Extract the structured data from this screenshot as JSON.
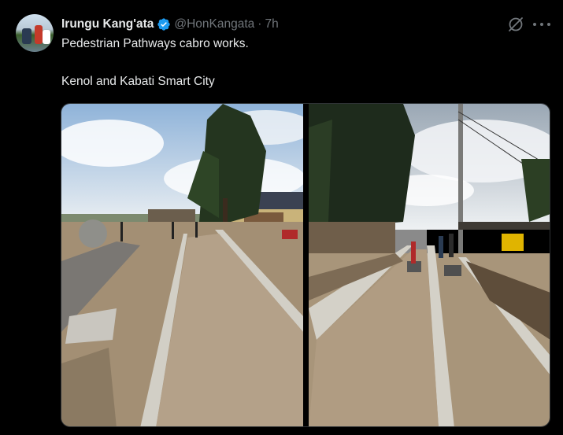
{
  "tweet": {
    "display_name": "Irungu Kang'ata",
    "handle": "@HonKangata",
    "separator": "·",
    "time": "7h",
    "text_line1": "Pedestrian Pathways cabro works.",
    "text_line2": "Kenol and Kabati Smart City"
  },
  "icons": {
    "verified": "verified-badge-icon",
    "grok": "grok-icon",
    "more": "more-options-icon"
  },
  "colors": {
    "background": "#000000",
    "text_primary": "#e7e9ea",
    "text_secondary": "#71767b",
    "verified_blue": "#1d9bf0"
  }
}
